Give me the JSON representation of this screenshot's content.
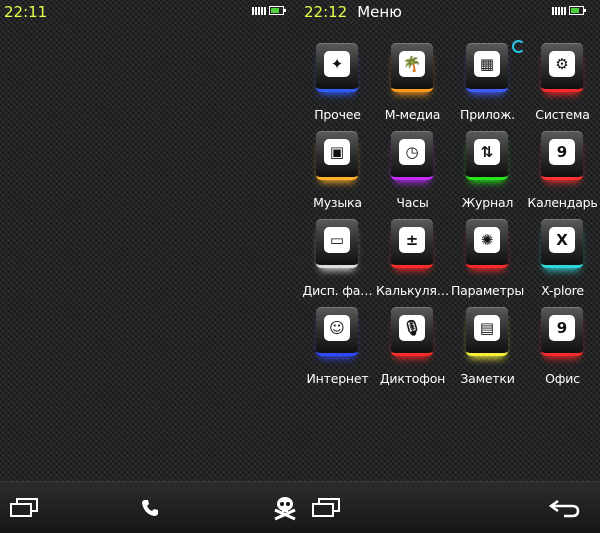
{
  "left_status": {
    "time": "22:11"
  },
  "right_status": {
    "time": "22:12",
    "title": "Меню"
  },
  "apps": [
    {
      "label": "Прочее",
      "icon": "sparkle-icon",
      "glyph": "✦",
      "accent": "#2f5dff"
    },
    {
      "label": "М-медиа",
      "icon": "palm-tree-icon",
      "glyph": "🌴",
      "accent": "#ff9b1a"
    },
    {
      "label": "Прилож.",
      "icon": "apps-grid-icon",
      "glyph": "▦",
      "accent": "#3f5cff"
    },
    {
      "label": "Система",
      "icon": "gear-icon",
      "glyph": "⚙",
      "accent": "#ff2a2a"
    },
    {
      "label": "Музыка",
      "icon": "music-player-icon",
      "glyph": "▣",
      "accent": "#ffb12a"
    },
    {
      "label": "Часы",
      "icon": "clock-icon",
      "glyph": "◷",
      "accent": "#c22dff"
    },
    {
      "label": "Журнал",
      "icon": "up-down-arrows-icon",
      "glyph": "⇅",
      "accent": "#26e51a"
    },
    {
      "label": "Календарь",
      "icon": "calendar-icon",
      "glyph": "9",
      "accent": "#ff3232"
    },
    {
      "label": "Дисп. файлов",
      "icon": "floppy-disk-icon",
      "glyph": "▭",
      "accent": "#dddddd"
    },
    {
      "label": "Калькулятор",
      "icon": "calculator-icon",
      "glyph": "±",
      "accent": "#ff2a2a"
    },
    {
      "label": "Параметры",
      "icon": "cog-wheel-icon",
      "glyph": "✺",
      "accent": "#ff2a2a"
    },
    {
      "label": "X-plore",
      "icon": "x-file-icon",
      "glyph": "X",
      "accent": "#2ed8d8"
    },
    {
      "label": "Интернет",
      "icon": "globe-face-icon",
      "glyph": "☺",
      "accent": "#3048ff"
    },
    {
      "label": "Диктофон",
      "icon": "microphone-icon",
      "glyph": "🎙",
      "accent": "#ff2a2a"
    },
    {
      "label": "Заметки",
      "icon": "notes-icon",
      "glyph": "▤",
      "accent": "#f6f03a"
    },
    {
      "label": "Офис",
      "icon": "office-calendar-icon",
      "glyph": "9",
      "accent": "#ff2a2a"
    }
  ],
  "colors": {
    "time": "#e8ff4a",
    "loading": "#29c6e8"
  }
}
